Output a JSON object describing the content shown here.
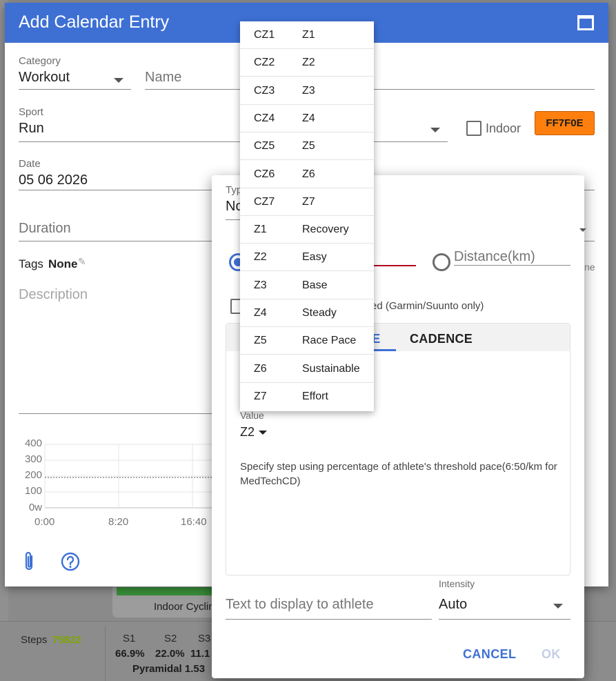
{
  "background": {
    "card_label": "Indoor Cyclin",
    "steps_label": "Steps",
    "steps_value": "75822",
    "stats_headers": [
      "S1",
      "S2",
      "S3"
    ],
    "stats_values": [
      "66.9%",
      "22.0%",
      "11.1"
    ],
    "pyramidal": "Pyramidal 1.53"
  },
  "main_dialog": {
    "title": "Add Calendar Entry",
    "category_label": "Category",
    "category_value": "Workout",
    "name_placeholder": "Name",
    "sport_label": "Sport",
    "sport_value": "Run",
    "indoor_label": "Indoor",
    "color_value": "FF7F0E",
    "date_label": "Date",
    "date_value": "05 06 2026",
    "duration_placeholder": "Duration",
    "tags_label": "Tags",
    "tags_value": "None",
    "description_placeholder": "Description",
    "chart_y_ticks": [
      "400",
      "300",
      "200",
      "100",
      "0w"
    ],
    "chart_x_ticks": [
      "0:00",
      "8:20",
      "16:40"
    ]
  },
  "step_dialog": {
    "type_label_partial": "Typ",
    "type_value_partial": "No",
    "distance_label": "Distance(km)",
    "trailing_partial": "ne",
    "checkbox_label_partial": "ed (Garmin/Suunto only)",
    "tab_active_partial": "CE",
    "tab_cadence": "CADENCE",
    "value_label": "Value",
    "value_selected": "Z2",
    "help_text": "Specify step using percentage of athlete's threshold pace(6:50/km for MedTechCD)",
    "text_placeholder": "Text to display to athlete",
    "intensity_label": "Intensity",
    "intensity_value": "Auto",
    "cancel_label": "CANCEL",
    "ok_label": "OK"
  },
  "zone_menu": [
    {
      "code": "CZ1",
      "name": "Z1"
    },
    {
      "code": "CZ2",
      "name": "Z2"
    },
    {
      "code": "CZ3",
      "name": "Z3"
    },
    {
      "code": "CZ4",
      "name": "Z4"
    },
    {
      "code": "CZ5",
      "name": "Z5"
    },
    {
      "code": "CZ6",
      "name": "Z6"
    },
    {
      "code": "CZ7",
      "name": "Z7"
    },
    {
      "code": "Z1",
      "name": "Recovery"
    },
    {
      "code": "Z2",
      "name": "Easy"
    },
    {
      "code": "Z3",
      "name": "Base"
    },
    {
      "code": "Z4",
      "name": "Steady"
    },
    {
      "code": "Z5",
      "name": "Race Pace"
    },
    {
      "code": "Z6",
      "name": "Sustainable"
    },
    {
      "code": "Z7",
      "name": "Effort"
    }
  ],
  "colors": {
    "header": "#3e70d4",
    "accent": "#3e70d4",
    "color_swatch": "#ff7f0e",
    "steps_green": "#7ea600"
  }
}
